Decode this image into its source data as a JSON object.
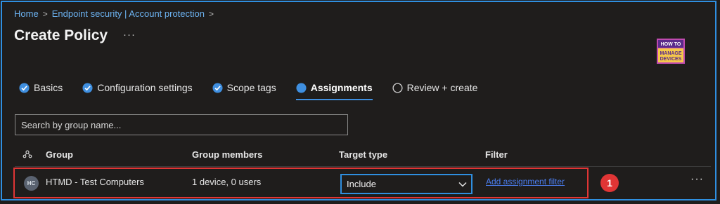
{
  "breadcrumb": {
    "home": "Home",
    "section": "Endpoint security | Account protection",
    "sep": ">"
  },
  "page": {
    "title": "Create Policy",
    "more": "···"
  },
  "logo": {
    "line1": "HOW TO",
    "line2": "MANAGE",
    "line3": "DEVICES"
  },
  "tabs": [
    {
      "label": "Basics",
      "state": "done"
    },
    {
      "label": "Configuration settings",
      "state": "done"
    },
    {
      "label": "Scope tags",
      "state": "done"
    },
    {
      "label": "Assignments",
      "state": "active"
    },
    {
      "label": "Review + create",
      "state": "pending"
    }
  ],
  "search": {
    "placeholder": "Search by group name..."
  },
  "table": {
    "headers": {
      "group": "Group",
      "members": "Group members",
      "target": "Target type",
      "filter": "Filter"
    },
    "row": {
      "avatar": "HC",
      "group": "HTMD - Test Computers",
      "members": "1 device, 0 users",
      "target": "Include",
      "filter": "Add assignment filter",
      "more": "···"
    }
  },
  "annotation": {
    "badge": "1"
  },
  "colors": {
    "accent": "#2f8fe0",
    "highlight": "#e03535",
    "background": "#1f1d1c"
  }
}
